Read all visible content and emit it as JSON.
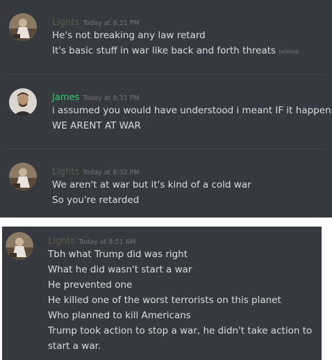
{
  "colors": {
    "background": "#36393f",
    "username_lights": "#5b5e4a",
    "username_james": "#2ecc71",
    "message_text": "#dcddde",
    "timestamp_text": "#72767d"
  },
  "messages": [
    {
      "username": "Lights",
      "timestamp": "Today at 8:31 PM",
      "lines": [
        "He's not breaking any law retard",
        "It's basic stuff in war like back and forth threats"
      ],
      "edited_label": "(edited)"
    },
    {
      "username": "James",
      "timestamp": "Today at 8:31 PM",
      "lines": [
        "i assumed you would have understood i meant IF it happens",
        "WE ARENT AT WAR"
      ]
    },
    {
      "username": "Lights",
      "timestamp": "Today at 8:32 PM",
      "lines": [
        "We aren't at war but it's kind of a cold war",
        "So you're retarded"
      ]
    },
    {
      "username": "Lights",
      "timestamp": "Today at 8:51 AM",
      "lines": [
        "Tbh what Trump did was right",
        "What he did wasn't start a war",
        "He prevented one",
        "He killed one of the worst terrorists on this planet",
        "Who planned to kill Americans",
        "Trump took action to stop a war, he didn't take action to",
        "start a war."
      ]
    }
  ]
}
